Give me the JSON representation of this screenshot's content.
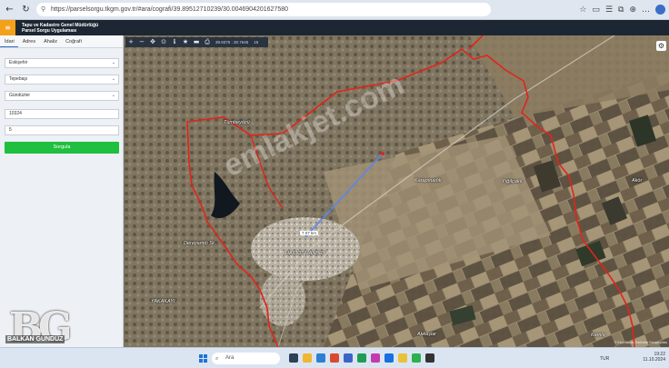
{
  "browser": {
    "url": "https://parselsorgu.tkgm.gov.tr/#ara/cografi/39.89512710239/30.0046904201627580",
    "back": "←",
    "refresh": "↻",
    "lock": "🔒"
  },
  "header": {
    "title_line1": "Tapu ve Kadastro Genel Müdürlüğü",
    "title_line2": "Parsel Sorgu Uygulaması",
    "menu_glyph": "≡"
  },
  "panel": {
    "tabs": [
      "İdari",
      "Adres",
      "Ahaliz",
      "Coğrafi"
    ],
    "fields": [
      {
        "value": "Eskişehir",
        "dropdown": true
      },
      {
        "value": "Tepebaşı",
        "dropdown": true
      },
      {
        "value": "Gündüzler",
        "dropdown": true
      },
      {
        "value": "10324",
        "dropdown": false
      },
      {
        "value": "5",
        "dropdown": false
      }
    ],
    "query_button": "Sorgula"
  },
  "map_toolbar": {
    "coordinates": "39.9375 : 30.7645",
    "zoom": "15"
  },
  "map": {
    "places": [
      {
        "name": "Tümbeyözü"
      },
      {
        "name": "Karapınarlık"
      },
      {
        "name": "Yığılçakıl"
      },
      {
        "name": "Akör"
      },
      {
        "name": "Dereyamdı Sr."
      },
      {
        "name": "HACIOSMANBEY"
      },
      {
        "name": "YAKAKAYI"
      },
      {
        "name": "Akkaşlar"
      },
      {
        "name": "Kamlıç"
      }
    ],
    "measurement": "7.07 km",
    "watermark": "emlakjet.com",
    "attribution": "© Esri, Maxar, Earthstar Geographics"
  },
  "logo": {
    "letters": "BG",
    "name": "BALKAN GÜNDÜZ"
  },
  "taskbar": {
    "search_placeholder": "Ara",
    "lang": "TUR",
    "time": "19:22",
    "date": "11.10.2024"
  },
  "colors": {
    "boundary": "#e2241b",
    "query_button": "#1fbf3f",
    "header": "#1d2733",
    "menu_accent": "#f4a11a"
  }
}
